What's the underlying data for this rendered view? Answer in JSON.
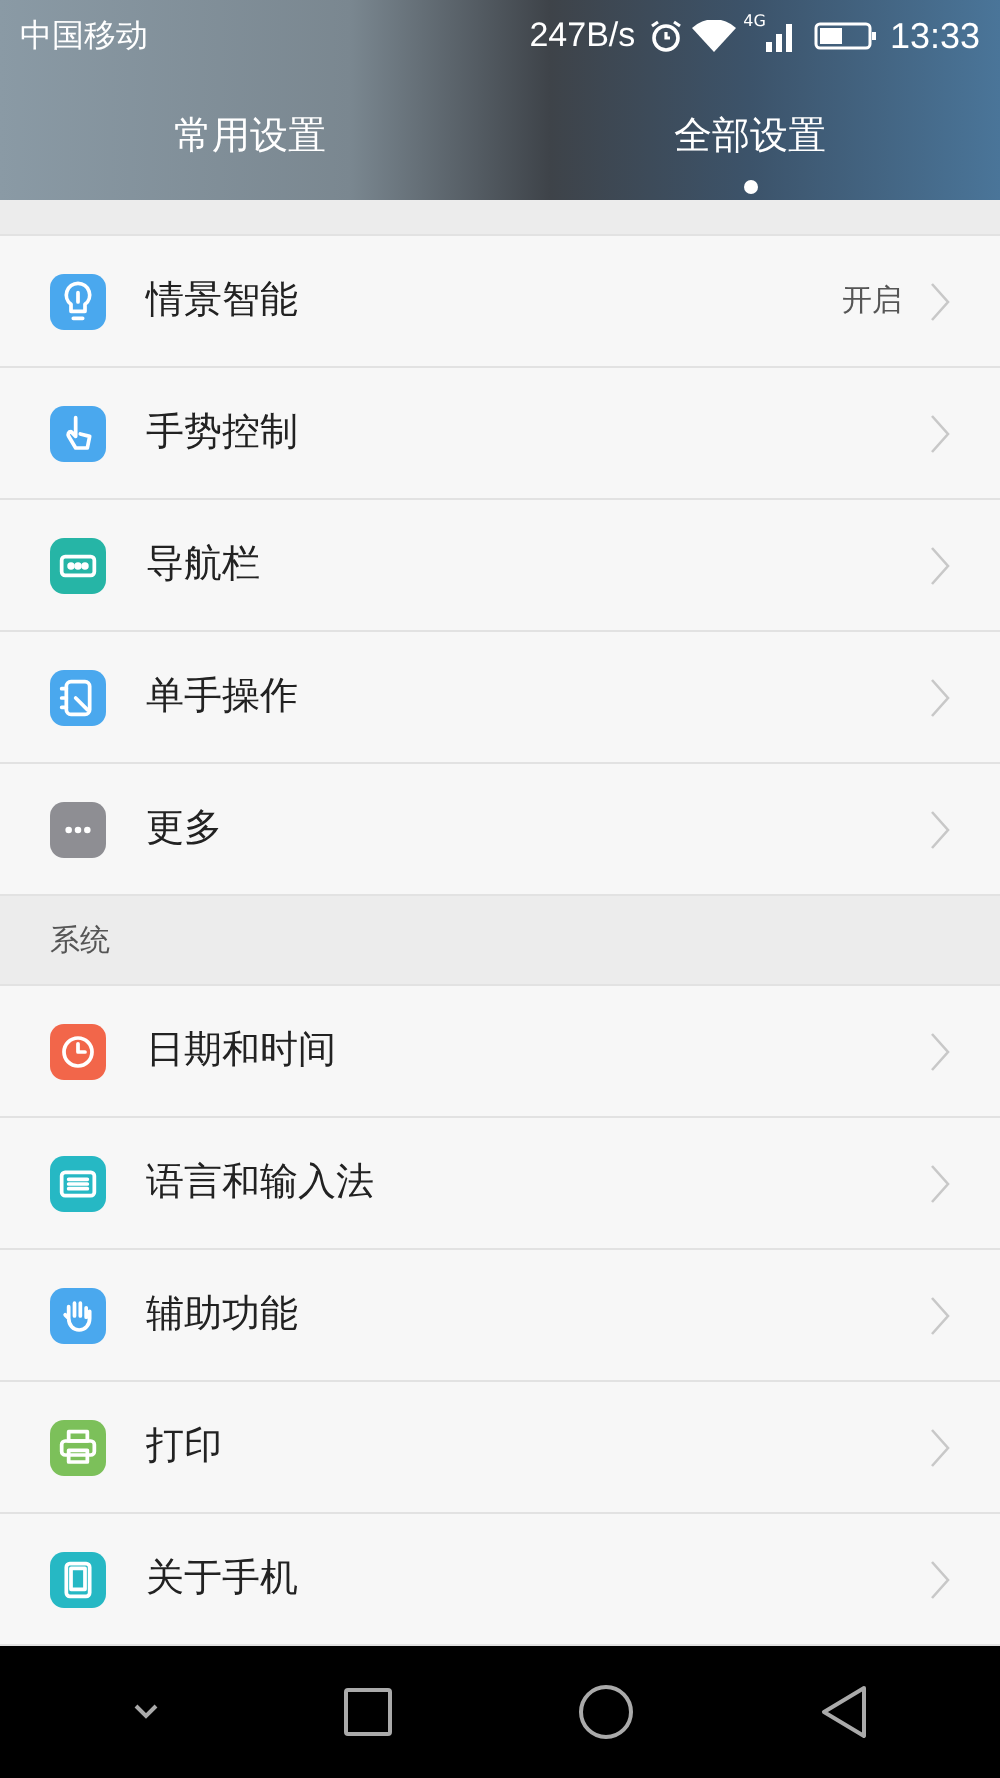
{
  "status_bar": {
    "carrier": "中国移动",
    "speed": "247B/s",
    "network": "4G",
    "time": "13:33"
  },
  "tabs": [
    {
      "label": "常用设置",
      "selected": false
    },
    {
      "label": "全部设置",
      "selected": true
    }
  ],
  "sections": [
    {
      "items": [
        {
          "label": "情景智能",
          "value": "开启",
          "color": "#4aa8ee"
        },
        {
          "label": "手势控制",
          "color": "#4aa8ee"
        },
        {
          "label": "导航栏",
          "color": "#26b5a6"
        },
        {
          "label": "单手操作",
          "color": "#4aa8ee"
        },
        {
          "label": "更多",
          "color": "#8e8e93"
        }
      ]
    },
    {
      "title": "系统",
      "items": [
        {
          "label": "日期和时间",
          "color": "#f2664a"
        },
        {
          "label": "语言和输入法",
          "color": "#26b8c4"
        },
        {
          "label": "辅助功能",
          "color": "#4aa8ee"
        },
        {
          "label": "打印",
          "color": "#7cc05a"
        },
        {
          "label": "关于手机",
          "color": "#26b8c4"
        }
      ]
    }
  ]
}
